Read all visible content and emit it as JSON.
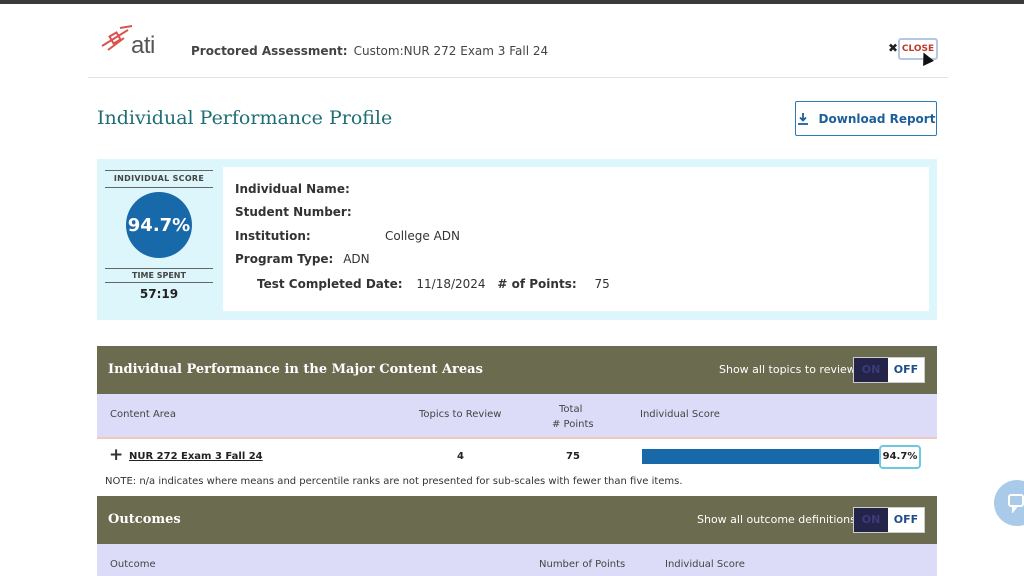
{
  "header": {
    "logo_text": "ati",
    "assessment_label": "Proctored Assessment:",
    "assessment_value": "Custom:NUR 272 Exam 3 Fall 24",
    "close_label": "CLOSE",
    "close_glyph": "✖"
  },
  "page": {
    "title": "Individual Performance Profile",
    "download_label": "Download Report"
  },
  "profile": {
    "score_label": "INDIVIDUAL SCORE",
    "score_value": "94.7%",
    "time_label": "TIME SPENT",
    "time_value": "57:19",
    "name_label": "Individual Name:",
    "student_number_label": "Student Number:",
    "institution_label": "Institution:",
    "institution_value": "College ADN",
    "program_type_label": "Program Type:",
    "program_type_value": "ADN",
    "completed_label": "Test Completed Date:",
    "completed_value": "11/18/2024",
    "points_label": "# of Points:",
    "points_value": "75"
  },
  "major": {
    "title": "Individual Performance in the Major Content Areas",
    "show_all_label": "Show all topics to review",
    "toggle_on": "ON",
    "toggle_off": "OFF",
    "columns": {
      "content_area": "Content Area",
      "topics": "Topics to Review",
      "total_line1": "Total",
      "total_line2": "# Points",
      "score": "Individual Score"
    },
    "rows": [
      {
        "name": "NUR 272 Exam 3 Fall 24",
        "topics": "4",
        "points": "75",
        "score": "94.7%",
        "score_fraction": 0.947
      }
    ],
    "note": "NOTE: n/a indicates where means and percentile ranks are not presented for sub-scales with fewer than five items."
  },
  "outcomes": {
    "title": "Outcomes",
    "show_all_label": "Show all outcome definitions",
    "toggle_on": "ON",
    "toggle_off": "OFF",
    "columns": {
      "outcome": "Outcome",
      "points": "Number of Points",
      "score": "Individual Score"
    }
  },
  "colors": {
    "accent_teal": "#1f6e74",
    "score_blue": "#1769a9",
    "section_olive": "#6b6b4f",
    "profile_bg": "#dcf6fb",
    "header_lavender": "#dcdcf9"
  },
  "icons": {
    "download": "download-icon",
    "close": "close-icon",
    "expand": "plus-icon",
    "chat": "chat-icon"
  }
}
